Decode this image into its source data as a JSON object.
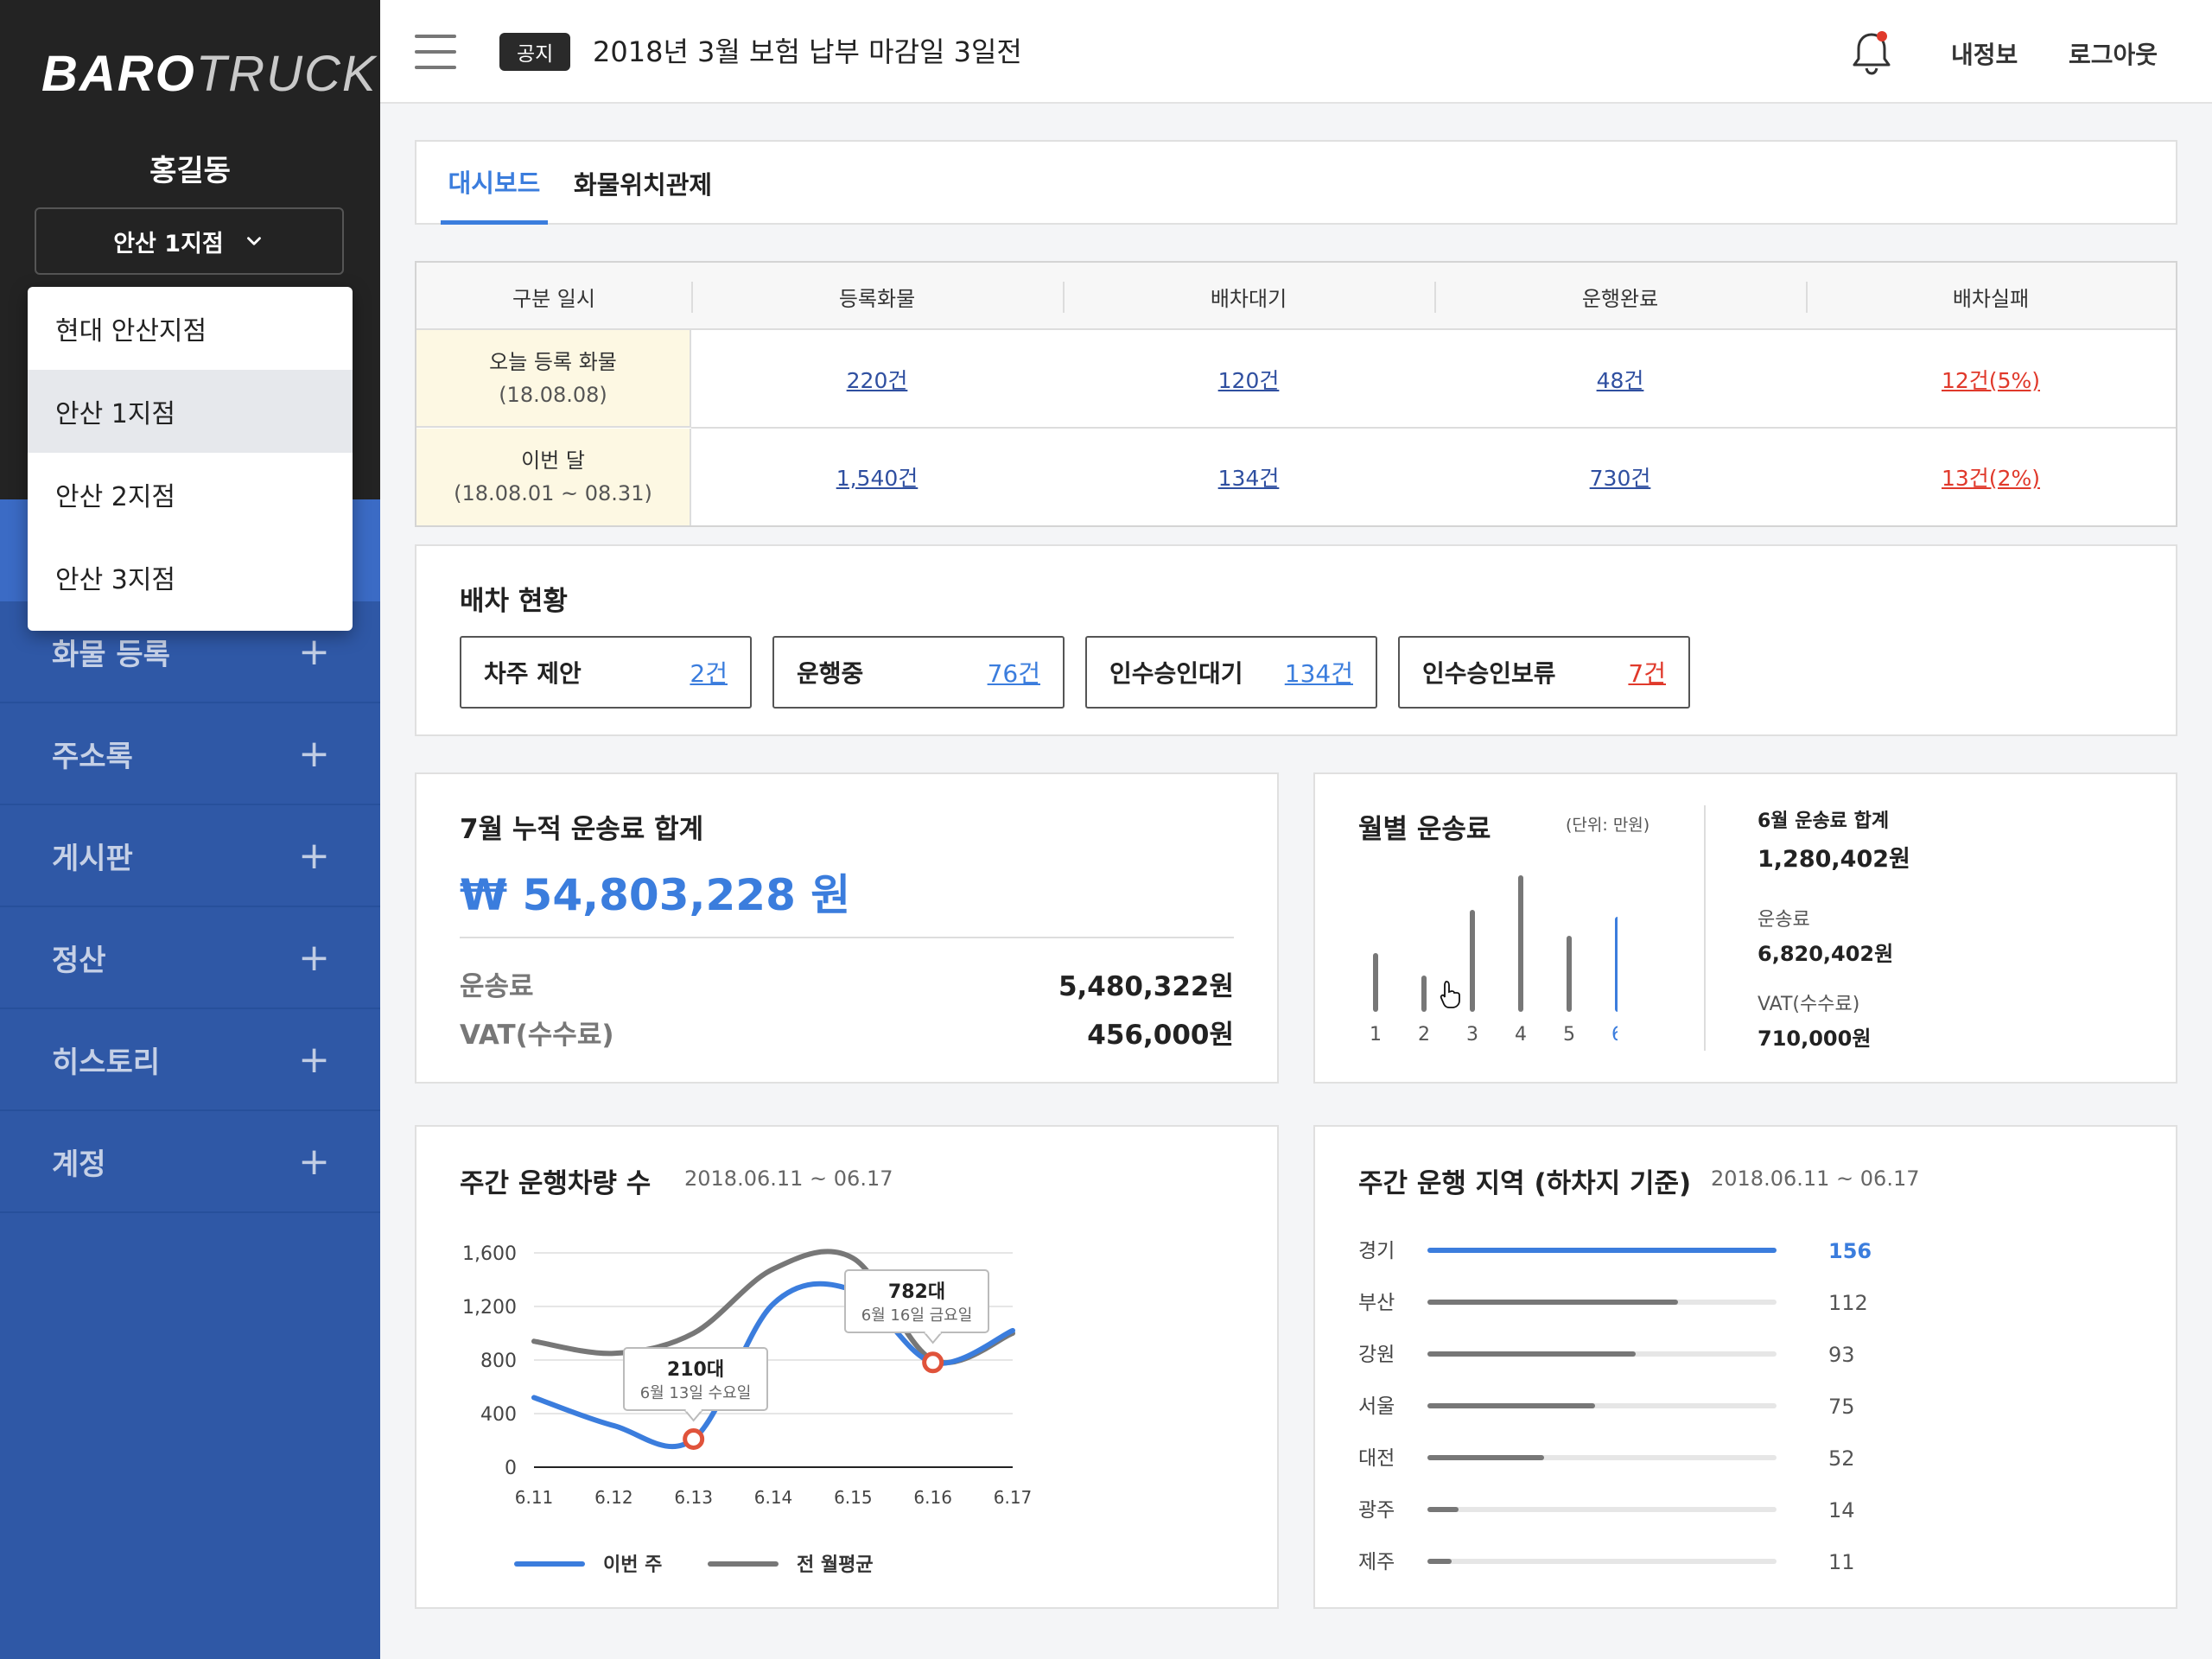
{
  "brand": {
    "logo_bold": "BARO",
    "logo_light": "TRUCK"
  },
  "user": {
    "name": "홍길동"
  },
  "branch": {
    "selected": "안산 1지점",
    "options": [
      "현대 안산지점",
      "안산 1지점",
      "안산 2지점",
      "안산 3지점"
    ]
  },
  "nav": {
    "items": [
      {
        "label": "화물 등록"
      },
      {
        "label": "주소록"
      },
      {
        "label": "게시판"
      },
      {
        "label": "정산"
      },
      {
        "label": "히스토리"
      },
      {
        "label": "계정"
      }
    ]
  },
  "header": {
    "notice_badge": "공지",
    "notice_text": "2018년 3월 보험 납부 마감일 3일전",
    "my_info": "내정보",
    "logout": "로그아웃",
    "has_notification": true
  },
  "tabs": [
    {
      "label": "대시보드",
      "active": true
    },
    {
      "label": "화물위치관제",
      "active": false
    }
  ],
  "summary": {
    "headers": [
      "구분 일시",
      "등록화물",
      "배차대기",
      "운행완료",
      "배차실패"
    ],
    "rows": [
      {
        "label": "오늘 등록 화물",
        "period": "(18.08.08)",
        "registered": "220건",
        "waiting": "120건",
        "completed": "48건",
        "failed": "12건(5%)"
      },
      {
        "label": "이번 달",
        "period": "(18.08.01 ~ 08.31)",
        "registered": "1,540건",
        "waiting": "134건",
        "completed": "730건",
        "failed": "13건(2%)"
      }
    ]
  },
  "dispatch": {
    "title": "배차 현황",
    "items": [
      {
        "label": "차주 제안",
        "value": "2건"
      },
      {
        "label": "운행중",
        "value": "76건"
      },
      {
        "label": "인수승인대기",
        "value": "134건"
      },
      {
        "label": "인수승인보류",
        "value": "7건"
      }
    ]
  },
  "cumulative": {
    "title": "7월 누적 운송료 합계",
    "total": "₩ 54,803,228 원",
    "fee_label": "운송료",
    "fee_value": "5,480,322원",
    "vat_label": "VAT(수수료)",
    "vat_value": "456,000원"
  },
  "monthly": {
    "title": "월별 운송료",
    "unit": "(단위: 만원)",
    "june_total_label": "6월 운송료 합계",
    "june_total_value": "1,280,402원",
    "fee_label": "운송료",
    "fee_value": "6,820,402원",
    "vat_label": "VAT(수수료)",
    "vat_value": "710,000원"
  },
  "weekly": {
    "title": "주간 운행차량 수",
    "date_range": "2018.06.11 ~ 06.17",
    "tooltips": [
      {
        "value": "210대",
        "date": "6월 13일 수요일"
      },
      {
        "value": "782대",
        "date": "6월 16일 금요일"
      }
    ]
  },
  "region": {
    "title": "주간 운행 지역 (하차지 기준)",
    "date_range": "2018.06.11 ~ 06.17",
    "rows": [
      {
        "label": "경기",
        "value": 156
      },
      {
        "label": "부산",
        "value": 112
      },
      {
        "label": "강원",
        "value": 93
      },
      {
        "label": "서울",
        "value": 75
      },
      {
        "label": "대전",
        "value": 52
      },
      {
        "label": "광주",
        "value": 14
      },
      {
        "label": "제주",
        "value": 11
      }
    ]
  },
  "chart_data": [
    {
      "type": "bar",
      "title": "월별 운송료",
      "unit": "(단위: 만원)",
      "categories": [
        "1",
        "2",
        "3",
        "4",
        "5",
        "6"
      ],
      "values": [
        62,
        36,
        112,
        152,
        82,
        104
      ],
      "highlight_index": 5,
      "colors": {
        "default": "#777777",
        "highlight": "#3b7ddd"
      }
    },
    {
      "type": "line",
      "title": "주간 운행차량 수",
      "x": [
        "6.11",
        "6.12",
        "6.13",
        "6.14",
        "6.15",
        "6.16",
        "6.17"
      ],
      "y_ticks": [
        "0",
        "400",
        "800",
        "1,200",
        "1,600"
      ],
      "ylim": [
        0,
        1600
      ],
      "series": [
        {
          "name": "이번 주",
          "color": "#3b7ddd",
          "values": [
            520,
            310,
            210,
            1220,
            1320,
            782,
            1020
          ]
        },
        {
          "name": "전 월평균",
          "color": "#777777",
          "values": [
            940,
            850,
            1000,
            1480,
            1560,
            800,
            1000
          ]
        }
      ],
      "highlights": [
        {
          "x": "6.13",
          "value": 210
        },
        {
          "x": "6.16",
          "value": 782
        }
      ],
      "legend_position": "bottom"
    },
    {
      "type": "bar",
      "title": "주간 운행 지역 (하차지 기준)",
      "categories": [
        "경기",
        "부산",
        "강원",
        "서울",
        "대전",
        "광주",
        "제주"
      ],
      "values": [
        156,
        112,
        93,
        75,
        52,
        14,
        11
      ],
      "colors": {
        "default": "#777777",
        "highlight": "#3b7ddd"
      }
    }
  ]
}
